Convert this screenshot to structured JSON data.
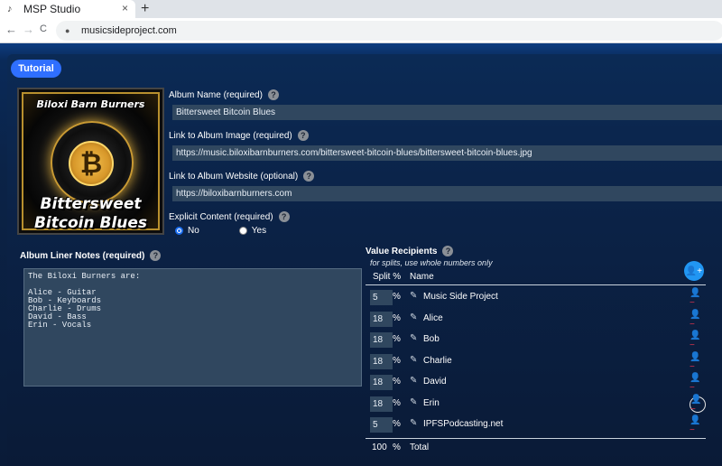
{
  "browser": {
    "tab_title": "MSP Studio",
    "tab_close": "×",
    "new_tab": "+",
    "url": "musicsideproject.com",
    "back": "←",
    "forward": "→",
    "reload": "C"
  },
  "tutorial_label": "Tutorial",
  "album_art": {
    "band_name": "Biloxi Barn Burners",
    "title_line1": "Bittersweet",
    "title_line2": "Bitcoin Blues",
    "coin_symbol": "₿"
  },
  "form": {
    "album_name_label": "Album Name (required)",
    "album_name_value": "Bittersweet Bitcoin Blues",
    "album_image_label": "Link to Album Image (required)",
    "album_image_value": "https://music.biloxibarnburners.com/bittersweet-bitcoin-blues/bittersweet-bitcoin-blues.jpg",
    "album_website_label": "Link to Album Website (optional)",
    "album_website_value": "https://biloxibarnburners.com",
    "explicit_label": "Explicit Content (required)",
    "explicit_options": [
      "No",
      "Yes"
    ],
    "explicit_selected": "No",
    "help_glyph": "?"
  },
  "liner_notes": {
    "label": "Album Liner Notes (required)",
    "text": "The Biloxi Burners are:\n\nAlice - Guitar\nBob - Keyboards\nCharlie - Drums\nDavid - Bass\nErin - Vocals"
  },
  "value_recipients": {
    "title": "Value Recipients",
    "subtitle": "for splits, use whole numbers only",
    "col_split": "Split %",
    "col_name": "Name",
    "percent_sign": "%",
    "rows": [
      {
        "split": "5",
        "name": "Music Side Project"
      },
      {
        "split": "18",
        "name": "Alice"
      },
      {
        "split": "18",
        "name": "Bob"
      },
      {
        "split": "18",
        "name": "Charlie"
      },
      {
        "split": "18",
        "name": "David"
      },
      {
        "split": "18",
        "name": "Erin"
      },
      {
        "split": "5",
        "name": "IPFSPodcasting.net"
      }
    ],
    "total_value": "100",
    "total_label": "Total"
  },
  "colors": {
    "accent": "#2f6fff",
    "add_button": "#2196f3",
    "remove_icon": "#e0344d",
    "input_bg": "#30475f"
  }
}
